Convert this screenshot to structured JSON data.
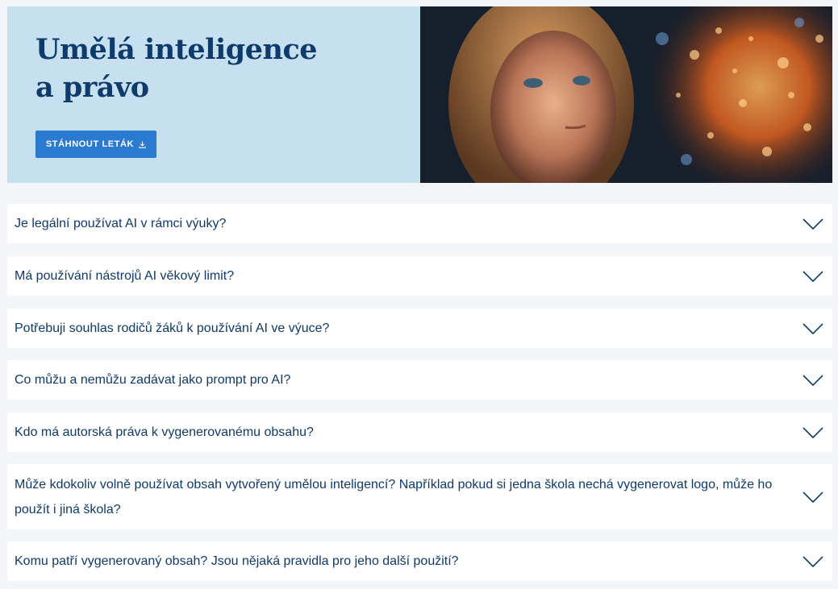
{
  "hero": {
    "title_line1": "Umělá inteligence",
    "title_line2": "a právo",
    "download_label": "STÁHNOUT LETÁK",
    "download_icon": "download-icon",
    "image_alt": "child-looking-at-glowing-sphere"
  },
  "faq": {
    "items": [
      {
        "question": "Je legální používat AI v rámci výuky?"
      },
      {
        "question": "Má používání nástrojů AI věkový limit?"
      },
      {
        "question": "Potřebuji souhlas rodičů žáků k používání AI ve výuce?"
      },
      {
        "question": "Co můžu a nemůžu zadávat jako prompt pro AI?"
      },
      {
        "question": "Kdo má autorská práva k vygenerovanému obsahu?"
      },
      {
        "question": "Může kdokoliv volně používat obsah vytvořený umělou inteligencí? Například pokud si jedna škola nechá vygenerovat logo, může ho použít i jiná škola?"
      },
      {
        "question": "Komu patří vygenerovaný obsah? Jsou nějaká pravidla pro jeho další použití?"
      }
    ],
    "toggle_icon": "chevron-down-icon"
  },
  "colors": {
    "primary": "#0e3a6c",
    "button": "#2a7ad1",
    "hero_bg": "#c7e0ef",
    "page_bg": "#f3f5f8"
  }
}
